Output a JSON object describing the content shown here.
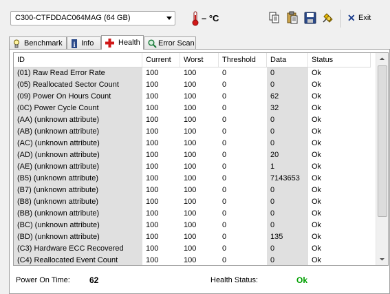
{
  "toolbar": {
    "drive": "C300-CTFDDAC064MAG (64 GB)",
    "temperature": "– °C",
    "exit_label": "Exit"
  },
  "tabs": [
    {
      "label": "Benchmark",
      "icon": "lightbulb-icon"
    },
    {
      "label": "Info",
      "icon": "info-icon"
    },
    {
      "label": "Health",
      "icon": "red-cross-icon",
      "active": true
    },
    {
      "label": "Error Scan",
      "icon": "magnifier-icon"
    }
  ],
  "table": {
    "columns": [
      "ID",
      "Current",
      "Worst",
      "Threshold",
      "Data",
      "Status"
    ],
    "rows": [
      [
        "(01) Raw Read Error Rate",
        "100",
        "100",
        "0",
        "0",
        "Ok"
      ],
      [
        "(05) Reallocated Sector Count",
        "100",
        "100",
        "0",
        "0",
        "Ok"
      ],
      [
        "(09) Power On Hours Count",
        "100",
        "100",
        "0",
        "62",
        "Ok"
      ],
      [
        "(0C) Power Cycle Count",
        "100",
        "100",
        "0",
        "32",
        "Ok"
      ],
      [
        "(AA) (unknown attribute)",
        "100",
        "100",
        "0",
        "0",
        "Ok"
      ],
      [
        "(AB) (unknown attribute)",
        "100",
        "100",
        "0",
        "0",
        "Ok"
      ],
      [
        "(AC) (unknown attribute)",
        "100",
        "100",
        "0",
        "0",
        "Ok"
      ],
      [
        "(AD) (unknown attribute)",
        "100",
        "100",
        "0",
        "20",
        "Ok"
      ],
      [
        "(AE) (unknown attribute)",
        "100",
        "100",
        "0",
        "1",
        "Ok"
      ],
      [
        "(B5) (unknown attribute)",
        "100",
        "100",
        "0",
        "7143653",
        "Ok"
      ],
      [
        "(B7) (unknown attribute)",
        "100",
        "100",
        "0",
        "0",
        "Ok"
      ],
      [
        "(B8) (unknown attribute)",
        "100",
        "100",
        "0",
        "0",
        "Ok"
      ],
      [
        "(BB) (unknown attribute)",
        "100",
        "100",
        "0",
        "0",
        "Ok"
      ],
      [
        "(BC) (unknown attribute)",
        "100",
        "100",
        "0",
        "0",
        "Ok"
      ],
      [
        "(BD) (unknown attribute)",
        "100",
        "100",
        "0",
        "135",
        "Ok"
      ],
      [
        "(C3) Hardware ECC Recovered",
        "100",
        "100",
        "0",
        "0",
        "Ok"
      ],
      [
        "(C4) Reallocated Event Count",
        "100",
        "100",
        "0",
        "0",
        "Ok"
      ]
    ]
  },
  "footer": {
    "power_on_label": "Power On Time:",
    "power_on_value": "62",
    "health_label": "Health Status:",
    "health_value": "Ok",
    "health_color": "#00a000"
  },
  "colors": {
    "id_column_bg": "#e0e0e0",
    "data_column_bg": "#e0e0e0"
  }
}
